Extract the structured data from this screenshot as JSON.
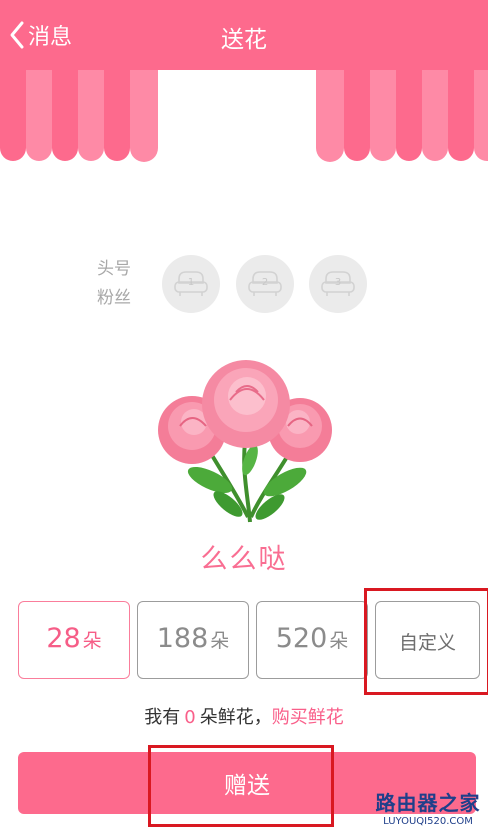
{
  "header": {
    "back_label": "消息",
    "title": "送花",
    "bg_color": "#fd6a8d"
  },
  "fans": {
    "label_line1": "头号",
    "label_line2": "粉丝",
    "ranks": [
      "1",
      "2",
      "3"
    ]
  },
  "gift": {
    "name": "么么哒"
  },
  "options": [
    {
      "number": "28",
      "unit": "朵",
      "selected": true
    },
    {
      "number": "188",
      "unit": "朵",
      "selected": false
    },
    {
      "number": "520",
      "unit": "朵",
      "selected": false
    },
    {
      "label": "自定义",
      "selected": false
    }
  ],
  "stock": {
    "prefix": "我有",
    "count": "0",
    "suffix": "朵鲜花，",
    "buy_link": "购买鲜花"
  },
  "send_button": "赠送",
  "watermark": {
    "text": "路由器之家",
    "url": "LUYOUQI520.COM"
  },
  "colors": {
    "accent": "#fd6a8d",
    "highlight": "#d91821"
  }
}
